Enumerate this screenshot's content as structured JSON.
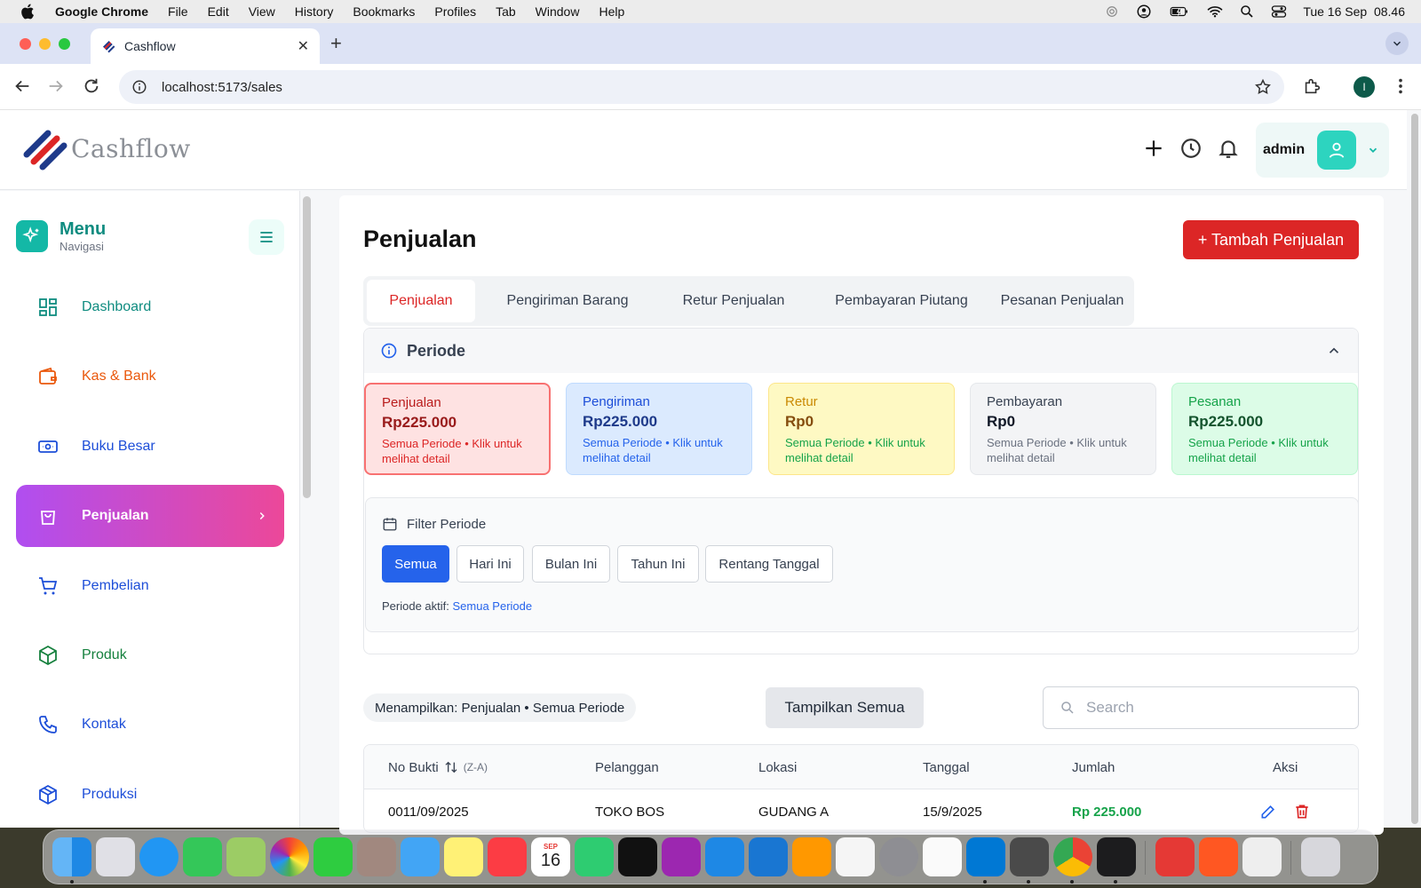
{
  "menubar": {
    "app_name": "Google Chrome",
    "items": [
      "File",
      "Edit",
      "View",
      "History",
      "Bookmarks",
      "Profiles",
      "Tab",
      "Window",
      "Help"
    ],
    "clock": "Tue 16 Sep  08.46"
  },
  "browser": {
    "tab_title": "Cashflow",
    "url": "localhost:5173/sales",
    "profile_initial": "I"
  },
  "header": {
    "brand": "Cashflow",
    "username": "admin"
  },
  "sidebar": {
    "title": "Menu",
    "subtitle": "Navigasi",
    "items": [
      {
        "label": "Dashboard",
        "icon": "dashboard-grid-icon",
        "color": "#0f8c80"
      },
      {
        "label": "Kas & Bank",
        "icon": "wallet-icon",
        "color": "#ea580c"
      },
      {
        "label": "Buku Besar",
        "icon": "cash-icon",
        "color": "#1d4ed8"
      },
      {
        "label": "Penjualan",
        "icon": "shopping-bag-icon",
        "color": "#ffffff"
      },
      {
        "label": "Pembelian",
        "icon": "cart-icon",
        "color": "#1d4ed8"
      },
      {
        "label": "Produk",
        "icon": "box-icon",
        "color": "#15803d"
      },
      {
        "label": "Kontak",
        "icon": "phone-icon",
        "color": "#1d4ed8"
      },
      {
        "label": "Produksi",
        "icon": "cube-icon",
        "color": "#1d4ed8"
      }
    ]
  },
  "page": {
    "title": "Penjualan",
    "add_button": "+ Tambah Penjualan",
    "tabs": [
      "Penjualan",
      "Pengiriman Barang",
      "Retur Penjualan",
      "Pembayaran Piutang",
      "Pesanan Penjualan"
    ],
    "periode_title": "Periode",
    "stats": [
      {
        "label": "Penjualan",
        "value": "Rp225.000",
        "desc": "Semua Periode • Klik untuk melihat detail"
      },
      {
        "label": "Pengiriman",
        "value": "Rp225.000",
        "desc": "Semua Periode • Klik untuk melihat detail"
      },
      {
        "label": "Retur",
        "value": "Rp0",
        "desc": "Semua Periode • Klik untuk melihat detail"
      },
      {
        "label": "Pembayaran",
        "value": "Rp0",
        "desc": "Semua Periode • Klik untuk melihat detail"
      },
      {
        "label": "Pesanan",
        "value": "Rp225.000",
        "desc": "Semua Periode • Klik untuk melihat detail"
      }
    ],
    "filter_title": "Filter Periode",
    "filters": [
      "Semua",
      "Hari Ini",
      "Bulan Ini",
      "Tahun Ini",
      "Rentang Tanggal"
    ],
    "periode_aktif_label": "Periode aktif:",
    "periode_aktif_value": "Semua Periode",
    "showing": "Menampilkan: Penjualan • Semua Periode",
    "show_all": "Tampilkan Semua",
    "search_placeholder": "Search"
  },
  "table": {
    "headers": [
      "No Bukti",
      "Pelanggan",
      "Lokasi",
      "Tanggal",
      "Jumlah",
      "Aksi"
    ],
    "sort_hint": "(Z-A)",
    "rows": [
      {
        "no_bukti": "0011/09/2025",
        "pelanggan": "TOKO BOS",
        "lokasi": "GUDANG A",
        "tanggal": "15/9/2025",
        "jumlah": "Rp 225.000"
      }
    ]
  },
  "colors": {
    "brand_teal": "#14b8a6",
    "accent_red": "#dc2626",
    "accent_blue": "#2563eb",
    "active_gradient_start": "#b04ef0",
    "active_gradient_end": "#ec4899"
  },
  "dock": {
    "apps": [
      "finder-icon",
      "launchpad-icon",
      "safari-icon",
      "messages-icon",
      "maps-icon",
      "photos-icon",
      "facetime-icon",
      "contacts-icon",
      "mail-icon",
      "notes-icon",
      "music-icon",
      "calendar-icon",
      "numbers-icon",
      "appletv-icon",
      "podcasts-icon",
      "keynote-icon",
      "appstore-icon",
      "pages-icon",
      "freeform-icon",
      "settings-icon",
      "reminders-icon",
      "vscode-icon",
      "sublime-icon",
      "chrome-icon",
      "terminal-icon",
      "git-icon",
      "pencil-app-icon",
      "textedit-icon",
      "trash-icon"
    ],
    "calendar_month": "SEP",
    "calendar_day": "16"
  }
}
